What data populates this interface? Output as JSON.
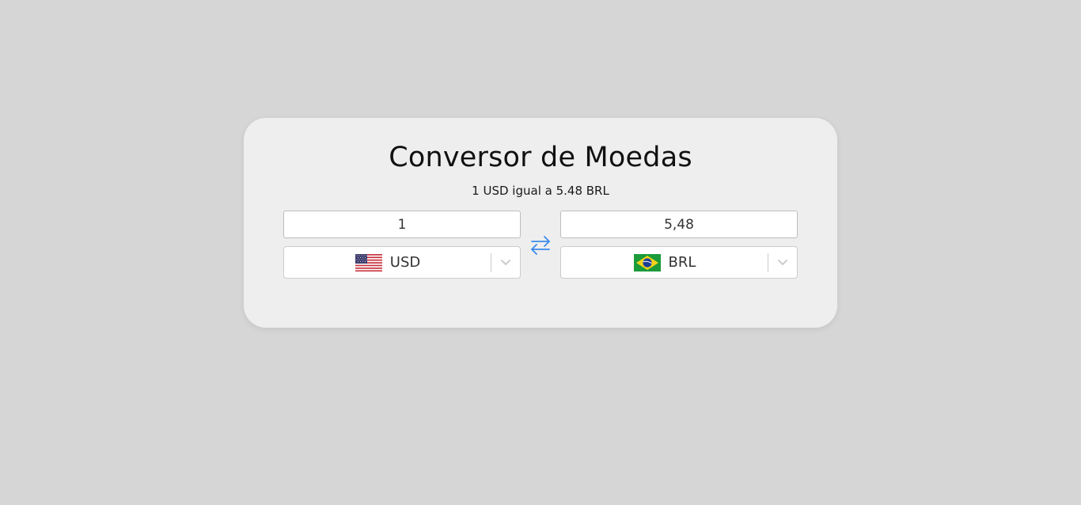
{
  "converter": {
    "title": "Conversor de Moedas",
    "rate_text": "1 USD igual a 5.48 BRL",
    "from": {
      "amount": "1",
      "currency": "USD",
      "flag_icon": "us-flag-icon"
    },
    "to": {
      "amount": "5,48",
      "currency": "BRL",
      "flag_icon": "brazil-flag-icon"
    },
    "swap_icon": "swap-arrows-icon",
    "accent_color": "#3b8bea"
  }
}
